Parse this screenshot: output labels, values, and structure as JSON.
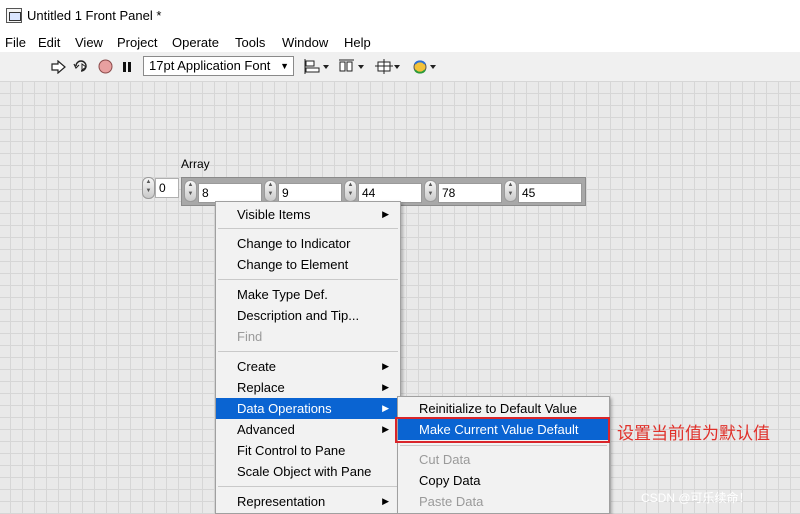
{
  "window": {
    "title": "Untitled 1 Front Panel *"
  },
  "menubar": [
    "File",
    "Edit",
    "View",
    "Project",
    "Operate",
    "Tools",
    "Window",
    "Help"
  ],
  "toolbar": {
    "icons": [
      "run-arrow-icon",
      "run-continuously-icon",
      "abort-icon",
      "pause-icon",
      "align-objects-icon",
      "distribute-objects-icon",
      "resize-objects-icon",
      "reorder-icon"
    ],
    "font": "17pt Application Font"
  },
  "array": {
    "label": "Array",
    "index": "0",
    "elements": [
      "8",
      "9",
      "44",
      "78",
      "45"
    ]
  },
  "context_menu": {
    "items": [
      {
        "label": "Visible Items",
        "submenu": true
      },
      {
        "label": "Change to Indicator"
      },
      {
        "label": "Change to Element"
      },
      {
        "label": "Make Type Def."
      },
      {
        "label": "Description and Tip..."
      },
      {
        "label": "Find",
        "disabled": true
      },
      {
        "label": "Create",
        "submenu": true
      },
      {
        "label": "Replace",
        "submenu": true
      },
      {
        "label": "Data Operations",
        "submenu": true,
        "highlighted": true
      },
      {
        "label": "Advanced",
        "submenu": true
      },
      {
        "label": "Fit Control to Pane"
      },
      {
        "label": "Scale Object with Pane"
      },
      {
        "label": "Representation",
        "submenu": true
      }
    ]
  },
  "submenu": {
    "items": [
      {
        "label": "Reinitialize to Default Value"
      },
      {
        "label": "Make Current Value Default",
        "highlighted": true
      },
      {
        "label": "Cut Data",
        "disabled": true
      },
      {
        "label": "Copy Data"
      },
      {
        "label": "Paste Data",
        "disabled": true
      }
    ]
  },
  "annotation": "设置当前值为默认值",
  "watermark": "CSDN @可乐续命！",
  "colors": {
    "highlight": "#0a64d2",
    "annotation": "#e0312b",
    "grid": "#d6d6d6",
    "canvas": "#e9e9e9"
  }
}
